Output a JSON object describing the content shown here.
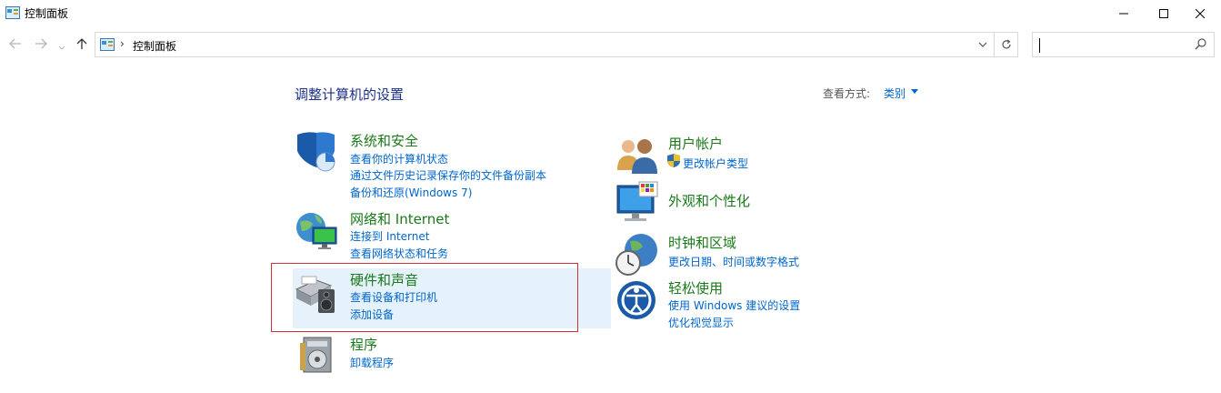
{
  "window": {
    "title": "控制面板"
  },
  "address": {
    "breadcrumb": "控制面板",
    "separator": "›"
  },
  "search": {
    "placeholder": ""
  },
  "main": {
    "heading": "调整计算机的设置",
    "view_by_label": "查看方式:",
    "view_by_value": "类别"
  },
  "categories": {
    "system_security": {
      "title": "系统和安全",
      "links": [
        "查看你的计算机状态",
        "通过文件历史记录保存你的文件备份副本",
        "备份和还原(Windows 7)"
      ]
    },
    "network_internet": {
      "title": "网络和 Internet",
      "links": [
        "连接到 Internet",
        "查看网络状态和任务"
      ]
    },
    "hardware_sound": {
      "title": "硬件和声音",
      "links": [
        "查看设备和打印机",
        "添加设备"
      ]
    },
    "programs": {
      "title": "程序",
      "links": [
        "卸载程序"
      ]
    },
    "user_accounts": {
      "title": "用户帐户",
      "links": [
        "更改帐户类型"
      ]
    },
    "appearance": {
      "title": "外观和个性化",
      "links": []
    },
    "clock_region": {
      "title": "时钟和区域",
      "links": [
        "更改日期、时间或数字格式"
      ]
    },
    "ease_of_access": {
      "title": "轻松使用",
      "links": [
        "使用 Windows 建议的设置",
        "优化视觉显示"
      ]
    }
  },
  "colors": {
    "category_title": "#1a7a1a",
    "link": "#0066cc",
    "heading": "#1e3287",
    "hover_bg": "#e5f1fb",
    "highlight_border": "#d0303a"
  }
}
